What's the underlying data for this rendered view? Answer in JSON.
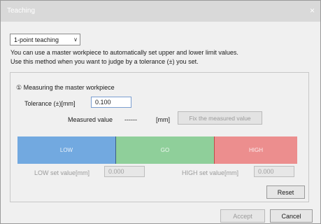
{
  "window": {
    "title": "Teaching",
    "close_label": "×"
  },
  "mode": {
    "selected": "1-point teaching"
  },
  "description": {
    "line1": "You can use a master workpiece to automatically set upper and lower limit values.",
    "line2": "Use this method when you want to judge by a tolerance (±) you set."
  },
  "measuring": {
    "title": "① Measuring the master workpiece",
    "tolerance_label": "Tolerance (±)[mm]",
    "tolerance_value": "0.100",
    "measured_label": "Measured value",
    "measured_value": "------",
    "unit": "[mm]",
    "fix_button": "Fix the measured value"
  },
  "judgement_bar": {
    "low": "LOW",
    "go": "GO",
    "high": "HIGH",
    "colors": {
      "low": "#72a9e0",
      "go": "#8fcf9a",
      "high": "#ec8e8e"
    }
  },
  "limits": {
    "low_label": "LOW set value[mm]",
    "low_value": "0.000",
    "high_label": "HIGH set value[mm]",
    "high_value": "0.000"
  },
  "buttons": {
    "reset": "Reset",
    "accept": "Accept",
    "cancel": "Cancel"
  }
}
